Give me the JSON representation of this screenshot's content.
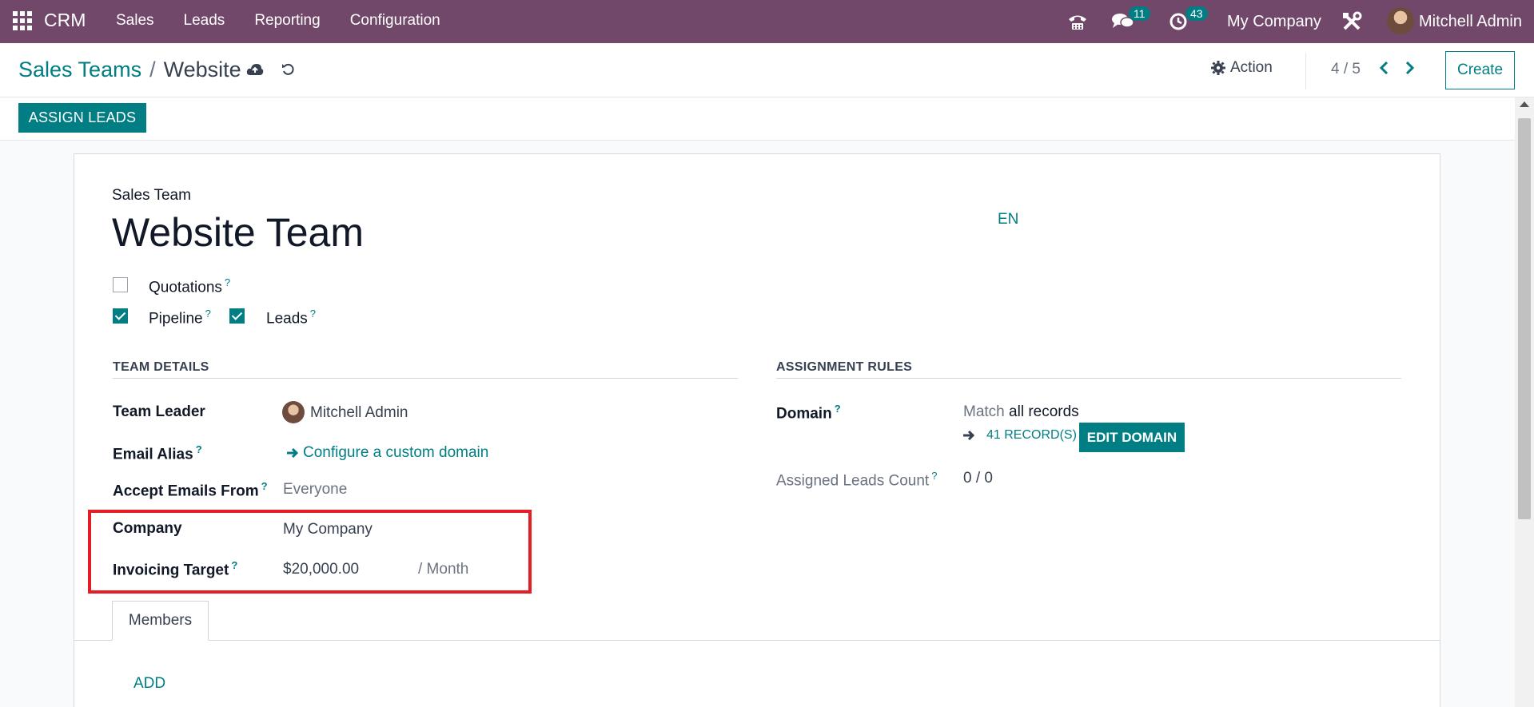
{
  "navbar": {
    "brand": "CRM",
    "menu": [
      "Sales",
      "Leads",
      "Reporting",
      "Configuration"
    ],
    "chat_count": "11",
    "activity_count": "43",
    "company": "My Company",
    "user": "Mitchell Admin"
  },
  "control": {
    "breadcrumb_parent": "Sales Teams",
    "breadcrumb_sep": "/",
    "breadcrumb_current": "Website",
    "action_label": "Action",
    "pager": "4 / 5",
    "create_label": "Create"
  },
  "statusbar": {
    "assign_leads": "ASSIGN LEADS"
  },
  "form": {
    "name_label": "Sales Team",
    "name": "Website Team",
    "lang": "EN",
    "checkboxes": {
      "quotations": {
        "label": "Quotations",
        "checked": false
      },
      "pipeline": {
        "label": "Pipeline",
        "checked": true
      },
      "leads": {
        "label": "Leads",
        "checked": true
      }
    },
    "team_details": {
      "title": "TEAM DETAILS",
      "team_leader_label": "Team Leader",
      "team_leader": "Mitchell Admin",
      "email_alias_label": "Email Alias",
      "email_alias_link": "Configure a custom domain",
      "accept_emails_label": "Accept Emails From",
      "accept_emails": "Everyone",
      "company_label": "Company",
      "company": "My Company",
      "invoicing_target_label": "Invoicing Target",
      "invoicing_target": "$20,000.00",
      "invoicing_period": "/ Month"
    },
    "assignment_rules": {
      "title": "ASSIGNMENT RULES",
      "domain_label": "Domain",
      "domain_match": "Match",
      "domain_scope": "all records",
      "records_link": "41 RECORD(S)",
      "edit_domain": "EDIT DOMAIN",
      "assigned_count_label": "Assigned Leads Count",
      "assigned_count": "0 / 0"
    },
    "tabs": [
      "Members"
    ],
    "add_label": "ADD"
  },
  "colors": {
    "navbar": "#71486a",
    "accent": "#017e84",
    "highlight": "#e31e25"
  }
}
